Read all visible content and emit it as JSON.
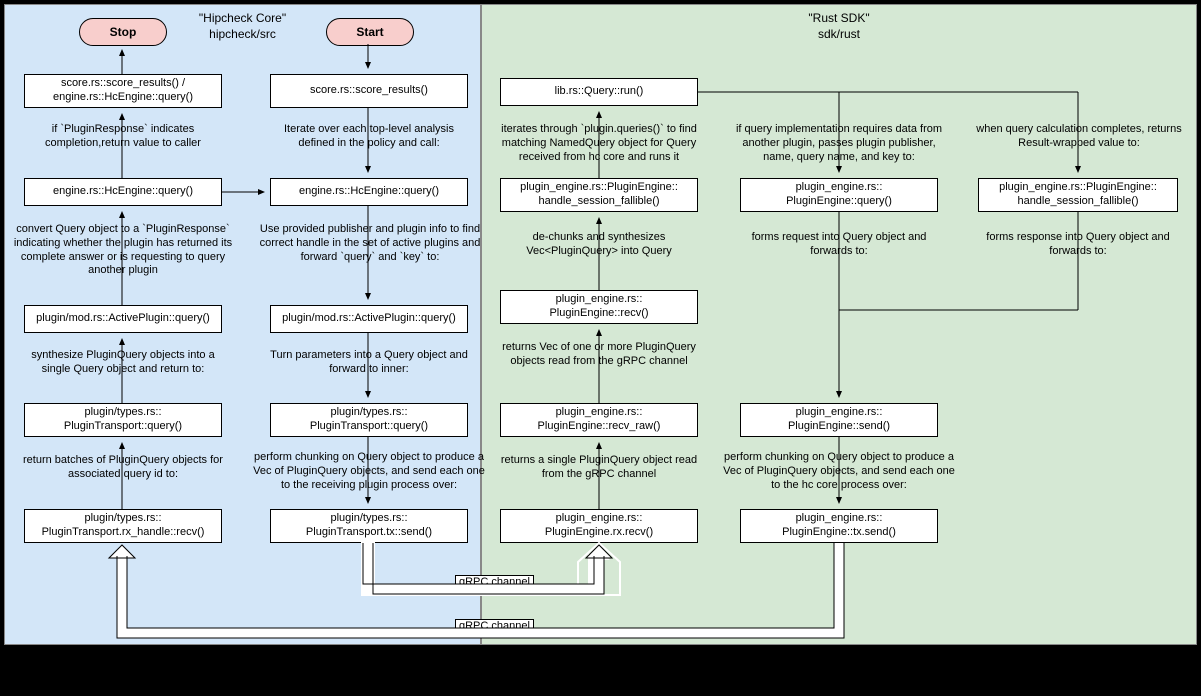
{
  "hipcheck": {
    "title_line1": "\"Hipcheck Core\"",
    "title_line2": "hipcheck/src",
    "stop": "Stop",
    "start": "Start",
    "col1": {
      "n1": "score.rs::score_results() /\nengine.rs::HcEngine::query()",
      "l1": "if `PluginResponse` indicates completion,return value to caller",
      "n2": "engine.rs::HcEngine::query()",
      "l2": "convert Query object to a `PluginResponse` indicating whether the plugin has returned its complete answer or is requesting to query another plugin",
      "n3": "plugin/mod.rs::ActivePlugin::query()",
      "l3": "synthesize PluginQuery objects into a single Query object and return to:",
      "n4": "plugin/types.rs::\nPluginTransport::query()",
      "l4": "return batches of PluginQuery objects for associated query id to:",
      "n5": "plugin/types.rs::\nPluginTransport.rx_handle::recv()"
    },
    "col2": {
      "n1": "score.rs::score_results()",
      "l1": "Iterate over each top-level analysis defined in the policy and call:",
      "n2": "engine.rs::HcEngine::query()",
      "l2": "Use provided publisher and plugin info to find correct handle in the set of active plugins and forward `query` and `key` to:",
      "n3": "plugin/mod.rs::ActivePlugin::query()",
      "l3": "Turn parameters into a Query object and forward to inner:",
      "n4": "plugin/types.rs::\nPluginTransport::query()",
      "l4": "perform chunking on Query object to produce a Vec of PluginQuery objects, and send each one to the receiving plugin process over:",
      "n5": "plugin/types.rs::\nPluginTransport.tx::send()"
    }
  },
  "rustsdk": {
    "title_line1": "\"Rust SDK\"",
    "title_line2": "sdk/rust",
    "top": "lib.rs::Query::run()",
    "col1": {
      "l1": "iterates through `plugin.queries()` to find matching NamedQuery object for Query received from hc core and runs it",
      "n1": "plugin_engine.rs::PluginEngine::\nhandle_session_fallible()",
      "l2": "de-chunks and synthesizes Vec<PluginQuery> into Query",
      "n2": "plugin_engine.rs::\nPluginEngine::recv()",
      "l3": "returns Vec of one or more PluginQuery objects read from the gRPC channel",
      "n3": "plugin_engine.rs::\nPluginEngine::recv_raw()",
      "l4": "returns a single PluginQuery object read from the gRPC channel",
      "n4": "plugin_engine.rs::\nPluginEngine.rx.recv()"
    },
    "col2": {
      "l1": "if query implementation requires data from another plugin, passes plugin publisher, name, query name, and key to:",
      "n1": "plugin_engine.rs::\nPluginEngine::query()",
      "l2": "forms request into Query object and forwards to:",
      "n3_send": "plugin_engine.rs::\nPluginEngine::send()",
      "l3": "perform chunking on Query object to produce a Vec of PluginQuery objects, and send each one to the hc core process over:",
      "n4": "plugin_engine.rs::\nPluginEngine::tx.send()"
    },
    "col3": {
      "l1": "when query calculation completes, returns Result-wrapped value to:",
      "n1": "plugin_engine.rs::PluginEngine::\nhandle_session_fallible()",
      "l2": "forms response into Query object and forwards to:"
    }
  },
  "grpc": "gRPC channel"
}
